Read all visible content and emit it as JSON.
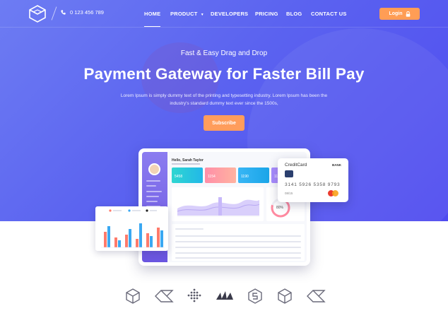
{
  "header": {
    "phone": "0 123 456 789",
    "nav": [
      {
        "label": "HOME",
        "active": true
      },
      {
        "label": "PRODUCT",
        "dropdown": true
      },
      {
        "label": "DEVELOPERS"
      },
      {
        "label": "PRICING"
      },
      {
        "label": "BLOG"
      },
      {
        "label": "CONTACT US"
      }
    ],
    "login_label": "Login"
  },
  "hero": {
    "tagline": "Fast & Easy Drag and Drop",
    "headline": "Payment Gateway for Faster Bill Pay",
    "description": "Lorem Ipsum is simply dummy text of the printing and typesetting industry. Lorem Ipsum has been the industry's standard dummy text ever since the 1500s,",
    "subscribe_label": "Subscribe"
  },
  "dashboard": {
    "greeting": "Hello, Sarah Taylor",
    "cards": [
      "5458",
      "1154",
      "1190",
      "1181"
    ],
    "donut_value": "80%"
  },
  "credit_card": {
    "brand": "CreditCard",
    "bank": "BANK",
    "number": "3141 5926 5358 9793",
    "expiry": "08/15"
  },
  "colors": {
    "accent": "#ff9d55",
    "hero_start": "#6d7cf3",
    "hero_end": "#4f4bf0"
  },
  "partners": [
    "cube-logo",
    "diamond-logo",
    "dots-logo",
    "triangles-logo",
    "s-logo",
    "cube-logo",
    "diamond-logo"
  ]
}
